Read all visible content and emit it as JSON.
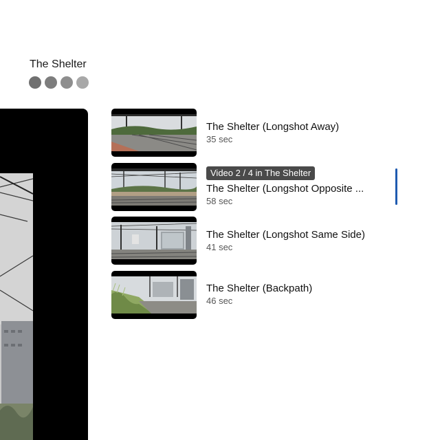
{
  "playlist": {
    "title": "The Shelter",
    "dots": [
      {
        "color": "#707070"
      },
      {
        "color": "#7d7d7d"
      },
      {
        "color": "#8e8e8e"
      },
      {
        "color": "#a8a8a8"
      }
    ]
  },
  "videos": [
    {
      "title": "The Shelter (Longshot Away)",
      "duration": "35 sec",
      "badge": ""
    },
    {
      "title": "The Shelter (Longshot Opposite ...",
      "duration": "58 sec",
      "badge": "Video 2 / 4 in The Shelter"
    },
    {
      "title": "The Shelter (Longshot Same Side)",
      "duration": "41 sec",
      "badge": ""
    },
    {
      "title": "The Shelter (Backpath)",
      "duration": "46 sec",
      "badge": ""
    }
  ],
  "colors": {
    "badge_bg": "#4a4a4a",
    "scroll_indicator": "#1f5bb0",
    "player_bg": "#000000"
  }
}
